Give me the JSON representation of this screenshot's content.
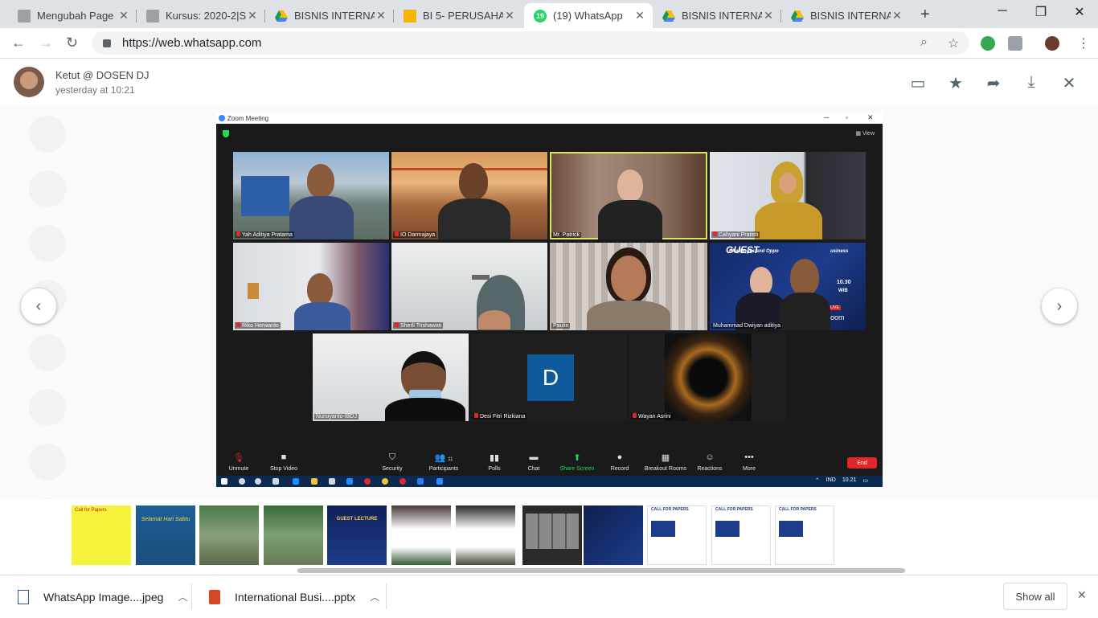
{
  "browser": {
    "tabs": [
      {
        "title": "Mengubah Page",
        "favicon": "page-icon"
      },
      {
        "title": "Kursus: 2020-2|S",
        "favicon": "page-icon"
      },
      {
        "title": "BISNIS INTERNA",
        "favicon": "drive-icon"
      },
      {
        "title": "BI 5- PERUSAHA",
        "favicon": "slides-icon"
      },
      {
        "title": "(19) WhatsApp",
        "favicon": "whatsapp-icon",
        "badge": "19",
        "active": true
      },
      {
        "title": "BISNIS INTERNA",
        "favicon": "drive-icon"
      },
      {
        "title": "BISNIS INTERNA",
        "favicon": "drive-icon"
      }
    ],
    "url": "https://web.whatsapp.com"
  },
  "viewer": {
    "sender": "Ketut @ DOSEN DJ",
    "timestamp": "yesterday at 10:21"
  },
  "zoom": {
    "window_title": "Zoom Meeting",
    "view_label": "View",
    "participants": [
      {
        "name": "Yah Aditiya Pratama",
        "muted": true
      },
      {
        "name": "IO Darmajaya",
        "muted": true
      },
      {
        "name": "Mr. Patrick",
        "muted": false,
        "speaking": true
      },
      {
        "name": "Cahyani Pratisti",
        "muted": true
      },
      {
        "name": "Riko Herwanto",
        "muted": true
      },
      {
        "name": "Sherli Trishawati",
        "muted": true
      },
      {
        "name": "Paulin",
        "muted": false
      },
      {
        "name": "Muhammad Dwiyan aditiya",
        "muted": true
      },
      {
        "name": "Nursiyanto-IBDJ",
        "muted": false
      },
      {
        "name": "Desi Fitri Rizkiana",
        "muted": true,
        "initial": "D"
      },
      {
        "name": "Wayan Asrini",
        "muted": true
      }
    ],
    "tile_text": {
      "banner_title": "GUEST",
      "banner_sub": "Challenges and Oppo",
      "banner_sub2": "usiness",
      "banner_time": "10.30",
      "banner_tz": "WIB",
      "live": "LIVE",
      "zoom_word": "oom"
    },
    "controls": [
      {
        "label": "Unmute",
        "icon": "mic-off-icon"
      },
      {
        "label": "Stop Video",
        "icon": "video-icon"
      },
      {
        "label": "Security",
        "icon": "shield-icon"
      },
      {
        "label": "Participants",
        "icon": "participants-icon",
        "count": "11"
      },
      {
        "label": "Polls",
        "icon": "polls-icon"
      },
      {
        "label": "Chat",
        "icon": "chat-icon"
      },
      {
        "label": "Share Screen",
        "icon": "share-screen-icon"
      },
      {
        "label": "Record",
        "icon": "record-icon"
      },
      {
        "label": "Breakout Rooms",
        "icon": "breakout-icon"
      },
      {
        "label": "Reactions",
        "icon": "reactions-icon"
      },
      {
        "label": "More",
        "icon": "more-icon"
      }
    ],
    "end_label": "End",
    "taskbar": {
      "lang": "IND",
      "clock": "10.21"
    }
  },
  "thumbnails": {
    "captions": [
      "Call for Papers",
      "Selamat Hari Sabtu",
      "",
      "",
      "GUEST LECTURE",
      "",
      "",
      "",
      "",
      "CALL FOR PAPERS",
      "CALL FOR PAPERS",
      "CALL FOR PAPERS"
    ]
  },
  "downloads": {
    "items": [
      {
        "name": "WhatsApp Image....jpeg",
        "icon": "image-file-icon"
      },
      {
        "name": "International Busi....pptx",
        "icon": "pptx-file-icon"
      }
    ],
    "show_all": "Show all"
  },
  "colors": {
    "whatsapp_green": "#25d366",
    "zoom_end_red": "#e02828",
    "zoom_speaker_outline": "#d6e85a",
    "zoom_share_green": "#23d959"
  }
}
